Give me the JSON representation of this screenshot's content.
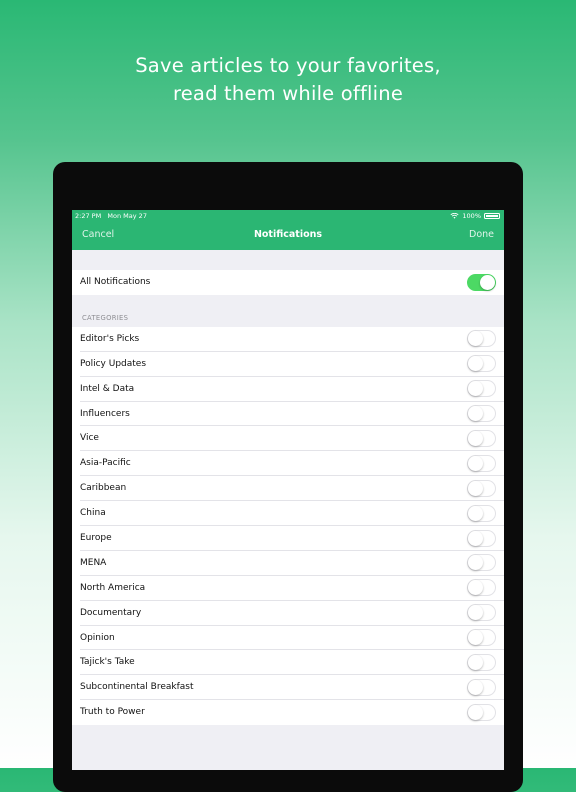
{
  "promo": {
    "line1": "Save articles to your favorites,",
    "line2": "read them while offline"
  },
  "status_bar": {
    "time": "2:27 PM",
    "date": "Mon May 27",
    "battery": "100%"
  },
  "nav": {
    "cancel_label": "Cancel",
    "title": "Notifications",
    "done_label": "Done"
  },
  "all_notifications": {
    "label": "All Notifications",
    "enabled": true
  },
  "categories": {
    "header": "CATEGORIES",
    "items": [
      {
        "label": "Editor's Picks",
        "enabled": false
      },
      {
        "label": "Policy Updates",
        "enabled": false
      },
      {
        "label": "Intel & Data",
        "enabled": false
      },
      {
        "label": "Influencers",
        "enabled": false
      },
      {
        "label": "Vice",
        "enabled": false
      },
      {
        "label": "Asia-Pacific",
        "enabled": false
      },
      {
        "label": "Caribbean",
        "enabled": false
      },
      {
        "label": "China",
        "enabled": false
      },
      {
        "label": "Europe",
        "enabled": false
      },
      {
        "label": "MENA",
        "enabled": false
      },
      {
        "label": "North America",
        "enabled": false
      },
      {
        "label": "Documentary",
        "enabled": false
      },
      {
        "label": "Opinion",
        "enabled": false
      },
      {
        "label": "Tajick's Take",
        "enabled": false
      },
      {
        "label": "Subcontinental Breakfast",
        "enabled": false
      },
      {
        "label": "Truth to Power",
        "enabled": false
      }
    ]
  },
  "colors": {
    "brand_green": "#2bb673",
    "toggle_on": "#4cd964"
  }
}
